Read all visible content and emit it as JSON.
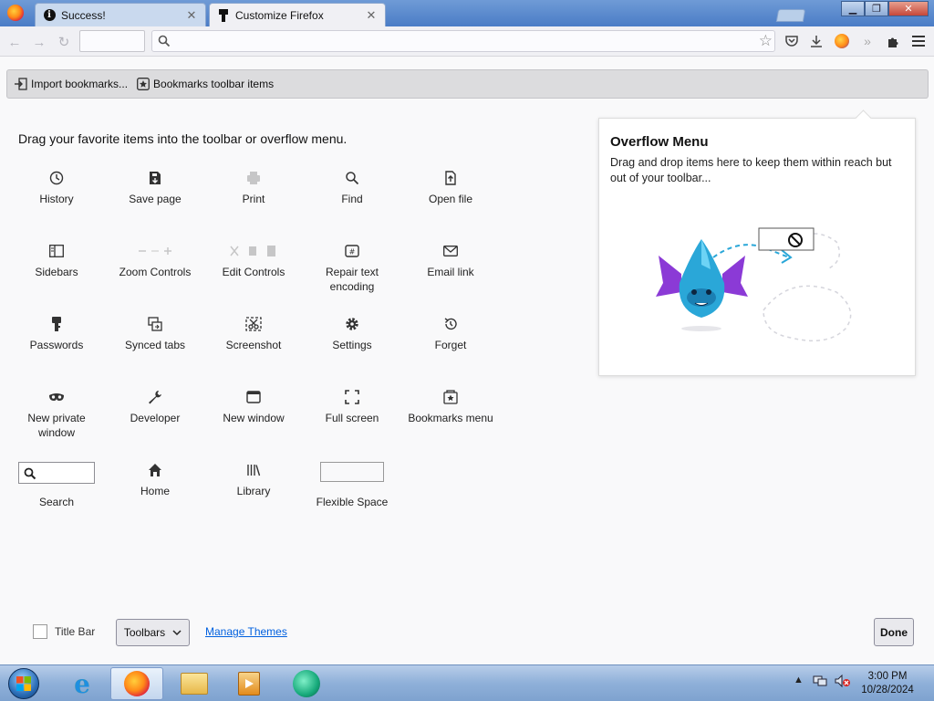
{
  "browser": {
    "tabs": [
      {
        "title": "Success!",
        "icon": "info-icon",
        "active": false
      },
      {
        "title": "Customize Firefox",
        "icon": "customize-icon",
        "active": true
      }
    ],
    "close_glyph": "✕"
  },
  "bookmarks_toolbar": {
    "items": [
      {
        "label": "Import bookmarks...",
        "icon": "import-icon"
      },
      {
        "label": "Bookmarks toolbar items",
        "icon": "bookmark-star-icon"
      }
    ]
  },
  "customize": {
    "heading": "Drag your favorite items into the toolbar or overflow menu.",
    "palette": [
      {
        "label": "History",
        "icon": "history-icon",
        "dim": false
      },
      {
        "label": "Save page",
        "icon": "save-page-icon",
        "dim": false
      },
      {
        "label": "Print",
        "icon": "print-icon",
        "dim": true
      },
      {
        "label": "Find",
        "icon": "find-icon",
        "dim": false
      },
      {
        "label": "Open file",
        "icon": "open-file-icon",
        "dim": false
      },
      {
        "label": "Sidebars",
        "icon": "sidebars-icon",
        "dim": false
      },
      {
        "label": "Zoom Controls",
        "icon": "zoom-controls-icon",
        "dim": true
      },
      {
        "label": "Edit Controls",
        "icon": "edit-controls-icon",
        "dim": true
      },
      {
        "label": "Repair text encoding",
        "icon": "repair-encoding-icon",
        "dim": false
      },
      {
        "label": "Email link",
        "icon": "email-link-icon",
        "dim": false
      },
      {
        "label": "Passwords",
        "icon": "passwords-icon",
        "dim": false
      },
      {
        "label": "Synced tabs",
        "icon": "synced-tabs-icon",
        "dim": false
      },
      {
        "label": "Screenshot",
        "icon": "screenshot-icon",
        "dim": false
      },
      {
        "label": "Settings",
        "icon": "settings-icon",
        "dim": false
      },
      {
        "label": "Forget",
        "icon": "forget-icon",
        "dim": false
      },
      {
        "label": "New private window",
        "icon": "private-window-icon",
        "dim": false
      },
      {
        "label": "Developer",
        "icon": "developer-icon",
        "dim": false
      },
      {
        "label": "New window",
        "icon": "new-window-icon",
        "dim": false
      },
      {
        "label": "Full screen",
        "icon": "full-screen-icon",
        "dim": false
      },
      {
        "label": "Bookmarks menu",
        "icon": "bookmarks-menu-icon",
        "dim": false
      },
      {
        "label": "Search",
        "icon": "search-widget",
        "dim": false
      },
      {
        "label": "Home",
        "icon": "home-icon",
        "dim": false
      },
      {
        "label": "Library",
        "icon": "library-icon",
        "dim": false
      },
      {
        "label": "Flexible Space",
        "icon": "flexible-space-widget",
        "dim": false
      }
    ],
    "overflow": {
      "title": "Overflow Menu",
      "description": "Drag and drop items here to keep them within reach but out of your toolbar..."
    },
    "footer": {
      "title_bar_label": "Title Bar",
      "title_bar_checked": false,
      "toolbars_label": "Toolbars",
      "manage_themes_label": "Manage Themes",
      "done_label": "Done"
    }
  },
  "taskbar": {
    "apps": [
      "internet-explorer-icon",
      "firefox-icon",
      "file-explorer-icon",
      "media-player-icon",
      "app-green-icon"
    ],
    "active_app": "firefox-icon",
    "clock_time": "3:00 PM",
    "clock_date": "10/28/2024"
  },
  "colors": {
    "titlebar": "#4a7cc6",
    "link": "#0060df",
    "accent_dragon": "#2aa7d8",
    "dragon_wing": "#8b3ad6"
  }
}
